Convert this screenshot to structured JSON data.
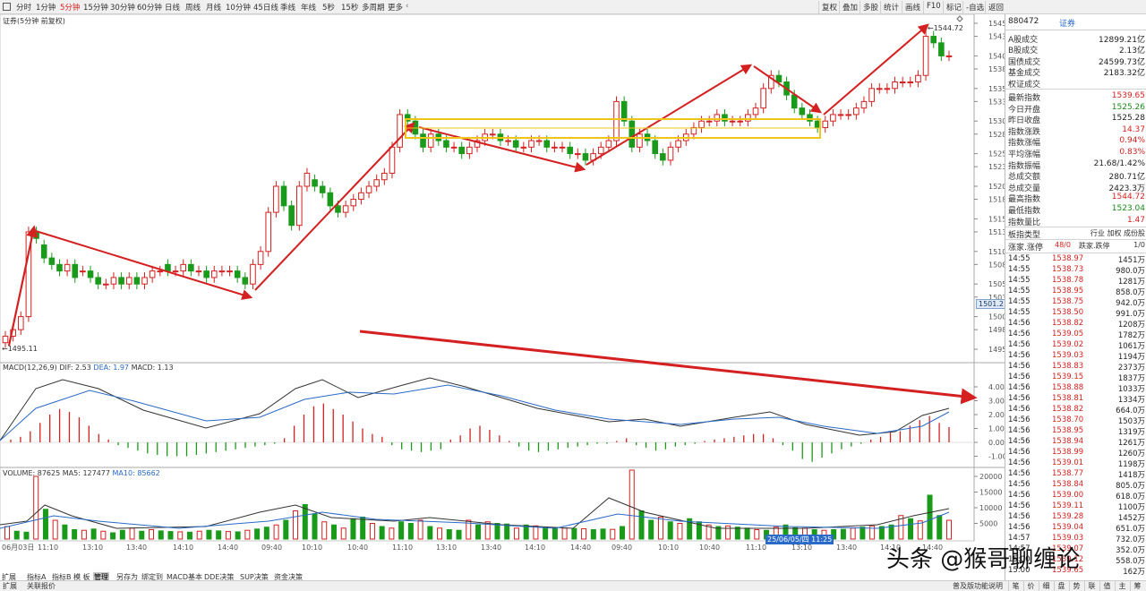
{
  "toolbar": {
    "periods": [
      "分时",
      "1分钟",
      "5分钟",
      "15分钟",
      "30分钟",
      "60分钟",
      "日线",
      "周线",
      "月线",
      "10分钟",
      "45日线",
      "季线",
      "年线",
      "5秒",
      "15秒",
      "多周期",
      "更多"
    ],
    "active_period": "5分钟",
    "right_buttons": [
      "复权",
      "叠加",
      "多股",
      "统计",
      "画线",
      "F10",
      "标记",
      "-自选",
      "返回"
    ]
  },
  "chart_title": "证券(5分钟 前复权)",
  "main_chart": {
    "last_price_tag": "1501.2",
    "low_label": "1495.11",
    "high_label": "1544.72",
    "y_ticks": [
      "1545",
      "1543",
      "1540",
      "1538",
      "1535",
      "1533",
      "1530",
      "1528",
      "1525",
      "1523",
      "1520",
      "1518",
      "1515",
      "1513",
      "1510",
      "1508",
      "1505",
      "1503",
      "1500",
      "1498",
      "1495"
    ],
    "colors": {
      "up": "#d42020",
      "down": "#1a9a1a",
      "arrow": "#d42020",
      "box": "#f0c419"
    }
  },
  "macd": {
    "label": "MACD(12,26,9)",
    "dif": "DIF: 2.53",
    "dea": "DEA: 1.97",
    "macd": "MACD: 1.13",
    "y_ticks": [
      "4.00",
      "3.00",
      "2.00",
      "1.00",
      "0.00",
      "-1.00"
    ]
  },
  "volume": {
    "label": "VOLUME: 87625",
    "ma5": "MA5: 127477",
    "ma10": "MA10: 85662",
    "y_ticks": [
      "20000",
      "15000",
      "10000",
      "5000"
    ]
  },
  "x_axis": [
    "06月03日",
    "11:10",
    "13:10",
    "13:40",
    "14:10",
    "14:40",
    "09:40",
    "10:10",
    "10:40",
    "11:10",
    "13:10",
    "13:40",
    "14:10",
    "14:40",
    "09:40",
    "10:10",
    "10:40",
    "11:10",
    "13:10",
    "13:40",
    "14:10",
    "14:40"
  ],
  "cursor_date": "25/06/05/四 11:25",
  "quote": {
    "code": "880472",
    "name": "证券",
    "rows_top": [
      {
        "label": "A股成交",
        "value": "12899.21亿"
      },
      {
        "label": "B股成交",
        "value": "2.13亿"
      },
      {
        "label": "国债成交",
        "value": "24599.73亿"
      },
      {
        "label": "基金成交",
        "value": "2183.32亿"
      },
      {
        "label": "权证成交",
        "value": ""
      }
    ],
    "rows_mid": [
      {
        "label": "最新指数",
        "value": "1539.65",
        "color": "red"
      },
      {
        "label": "今日开盘",
        "value": "1525.26",
        "color": "green"
      },
      {
        "label": "昨日收盘",
        "value": "1525.28",
        "color": ""
      },
      {
        "label": "指数涨跌",
        "value": "14.37",
        "color": "red"
      },
      {
        "label": "指数涨幅",
        "value": "0.94%",
        "color": "red"
      },
      {
        "label": "平均涨幅",
        "value": "0.83%",
        "color": "red"
      },
      {
        "label": "指数振幅",
        "value": "21.68/1.42%",
        "color": ""
      },
      {
        "label": "总成交额",
        "value": "280.71亿",
        "color": ""
      },
      {
        "label": "总成交量",
        "value": "2423.3万",
        "color": ""
      },
      {
        "label": "最高指数",
        "value": "1544.72",
        "color": "red"
      },
      {
        "label": "最低指数",
        "value": "1523.04",
        "color": "green"
      },
      {
        "label": "指数量比",
        "value": "1.47",
        "color": "red"
      }
    ],
    "type_label": "板指类型",
    "type_values": "行业 加权 成份股",
    "up_label": "涨家.涨停",
    "up_value": "48/0",
    "down_label": "跌家.跌停",
    "down_value": "1/0",
    "ticks": [
      {
        "t": "14:55",
        "p": "1538.97",
        "v": "1451万"
      },
      {
        "t": "14:55",
        "p": "1538.73",
        "v": "980.0万"
      },
      {
        "t": "14:55",
        "p": "1538.78",
        "v": "1281万"
      },
      {
        "t": "14:55",
        "p": "1538.95",
        "v": "858.0万"
      },
      {
        "t": "14:55",
        "p": "1538.75",
        "v": "942.0万"
      },
      {
        "t": "14:55",
        "p": "1538.50",
        "v": "991.0万"
      },
      {
        "t": "14:56",
        "p": "1538.82",
        "v": "1208万"
      },
      {
        "t": "14:56",
        "p": "1539.05",
        "v": "1782万"
      },
      {
        "t": "14:56",
        "p": "1539.02",
        "v": "1061万"
      },
      {
        "t": "14:56",
        "p": "1539.03",
        "v": "1194万"
      },
      {
        "t": "14:56",
        "p": "1538.83",
        "v": "2373万"
      },
      {
        "t": "14:56",
        "p": "1539.15",
        "v": "1837万"
      },
      {
        "t": "14:56",
        "p": "1538.88",
        "v": "1033万"
      },
      {
        "t": "14:56",
        "p": "1538.81",
        "v": "1334万"
      },
      {
        "t": "14:56",
        "p": "1538.82",
        "v": "664.0万"
      },
      {
        "t": "14:56",
        "p": "1538.70",
        "v": "1503万"
      },
      {
        "t": "14:56",
        "p": "1538.95",
        "v": "1319万"
      },
      {
        "t": "14:56",
        "p": "1538.94",
        "v": "1261万"
      },
      {
        "t": "14:56",
        "p": "1538.99",
        "v": "1260万"
      },
      {
        "t": "14:56",
        "p": "1539.01",
        "v": "1198万"
      },
      {
        "t": "14:56",
        "p": "1538.77",
        "v": "1418万"
      },
      {
        "t": "14:56",
        "p": "1538.84",
        "v": "805.0万"
      },
      {
        "t": "14:56",
        "p": "1539.00",
        "v": "618.0万"
      },
      {
        "t": "14:56",
        "p": "1539.11",
        "v": "1100万"
      },
      {
        "t": "14:56",
        "p": "1539.28",
        "v": "1452万"
      },
      {
        "t": "14:56",
        "p": "1539.04",
        "v": "651.0万"
      },
      {
        "t": "14:57",
        "p": "1539.03",
        "v": "732.0万"
      },
      {
        "t": "14:57",
        "p": "1539.07",
        "v": "352.0万"
      },
      {
        "t": "15:00",
        "p": "1539.12",
        "v": "558.0万"
      },
      {
        "t": "15:00",
        "p": "1539.65",
        "v": "162万"
      }
    ]
  },
  "bottom_tabs": [
    "扩展",
    "指标A",
    "指标B",
    "模 板",
    "管理",
    "另存为",
    "绑定到",
    "MACD基本",
    "DDE决策",
    "SUP决策",
    "资金决策"
  ],
  "active_tab": "管理",
  "status": {
    "left1": "扩展",
    "left2": "关联报价",
    "right": "普及版功能说明",
    "icons": [
      "笔",
      "价",
      "细",
      "盘",
      "势",
      "联",
      "值",
      "主",
      "筹"
    ]
  },
  "watermark": "头条 @猴哥聊缠论"
}
